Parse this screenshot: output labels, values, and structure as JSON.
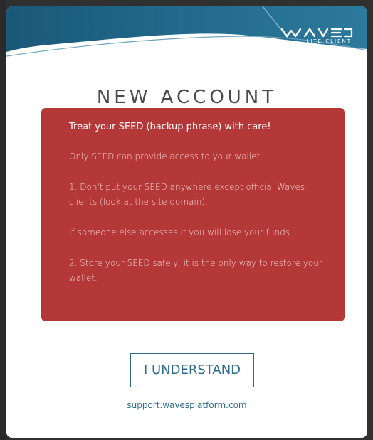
{
  "header": {
    "logo_name": "WAVES",
    "logo_subtitle": "LITE CLIENT",
    "brand_color": "#1d5f7f"
  },
  "page": {
    "title": "NEW ACCOUNT"
  },
  "warning": {
    "heading": "Treat your SEED (backup phrase) with care!",
    "paragraphs": [
      "Only SEED can provide access to your wallet.",
      "1. Don't put your SEED anywhere except official Waves clients (look at the site domain).",
      "If someone else accesses it you will lose your funds.",
      "2. Store your SEED safely, it is the only way to restore your wallet."
    ],
    "background_color": "#b53838"
  },
  "actions": {
    "understand_label": "I UNDERSTAND"
  },
  "footer": {
    "support_link": "support.wavesplatform.com"
  },
  "colors": {
    "accent": "#2d6b8e",
    "backdrop": "#303030"
  }
}
